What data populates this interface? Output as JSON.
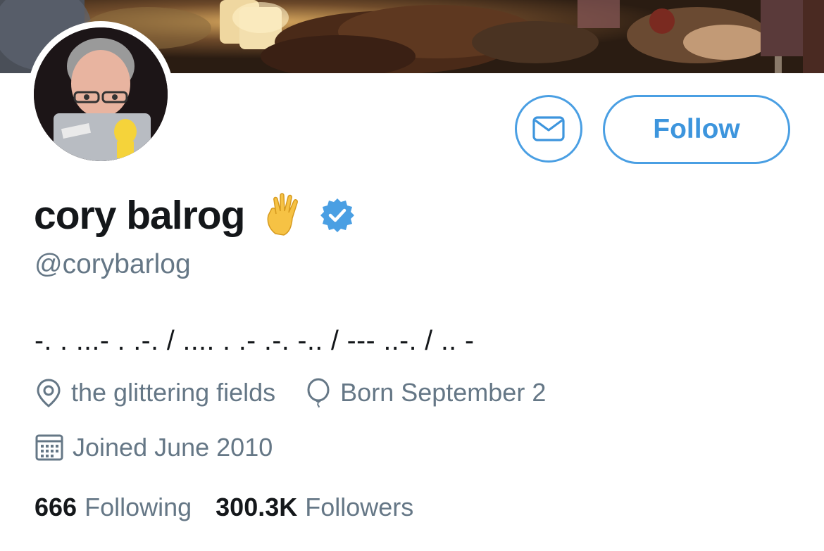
{
  "profile": {
    "display_name": "cory balrog",
    "handle": "@corybarlog",
    "bio": "-. . ...- . .-. / .... . .- .-. -.. / --- ..-. / .. -",
    "location": "the glittering fields",
    "birthday": "Born September 2",
    "joined": "Joined June 2010"
  },
  "stats": {
    "following_count": "666",
    "following_label": "Following",
    "followers_count": "300.3K",
    "followers_label": "Followers"
  },
  "actions": {
    "follow_label": "Follow"
  },
  "colors": {
    "accent": "#4a9fe3",
    "text_primary": "#14171a",
    "text_secondary": "#657786",
    "verified": "#4a9fe3"
  },
  "icons": {
    "message": "envelope-icon",
    "location": "location-pin-icon",
    "birthday": "balloon-icon",
    "joined": "calendar-icon",
    "verified": "verified-badge-icon",
    "name_emoji": "vulcan-salute-icon"
  }
}
